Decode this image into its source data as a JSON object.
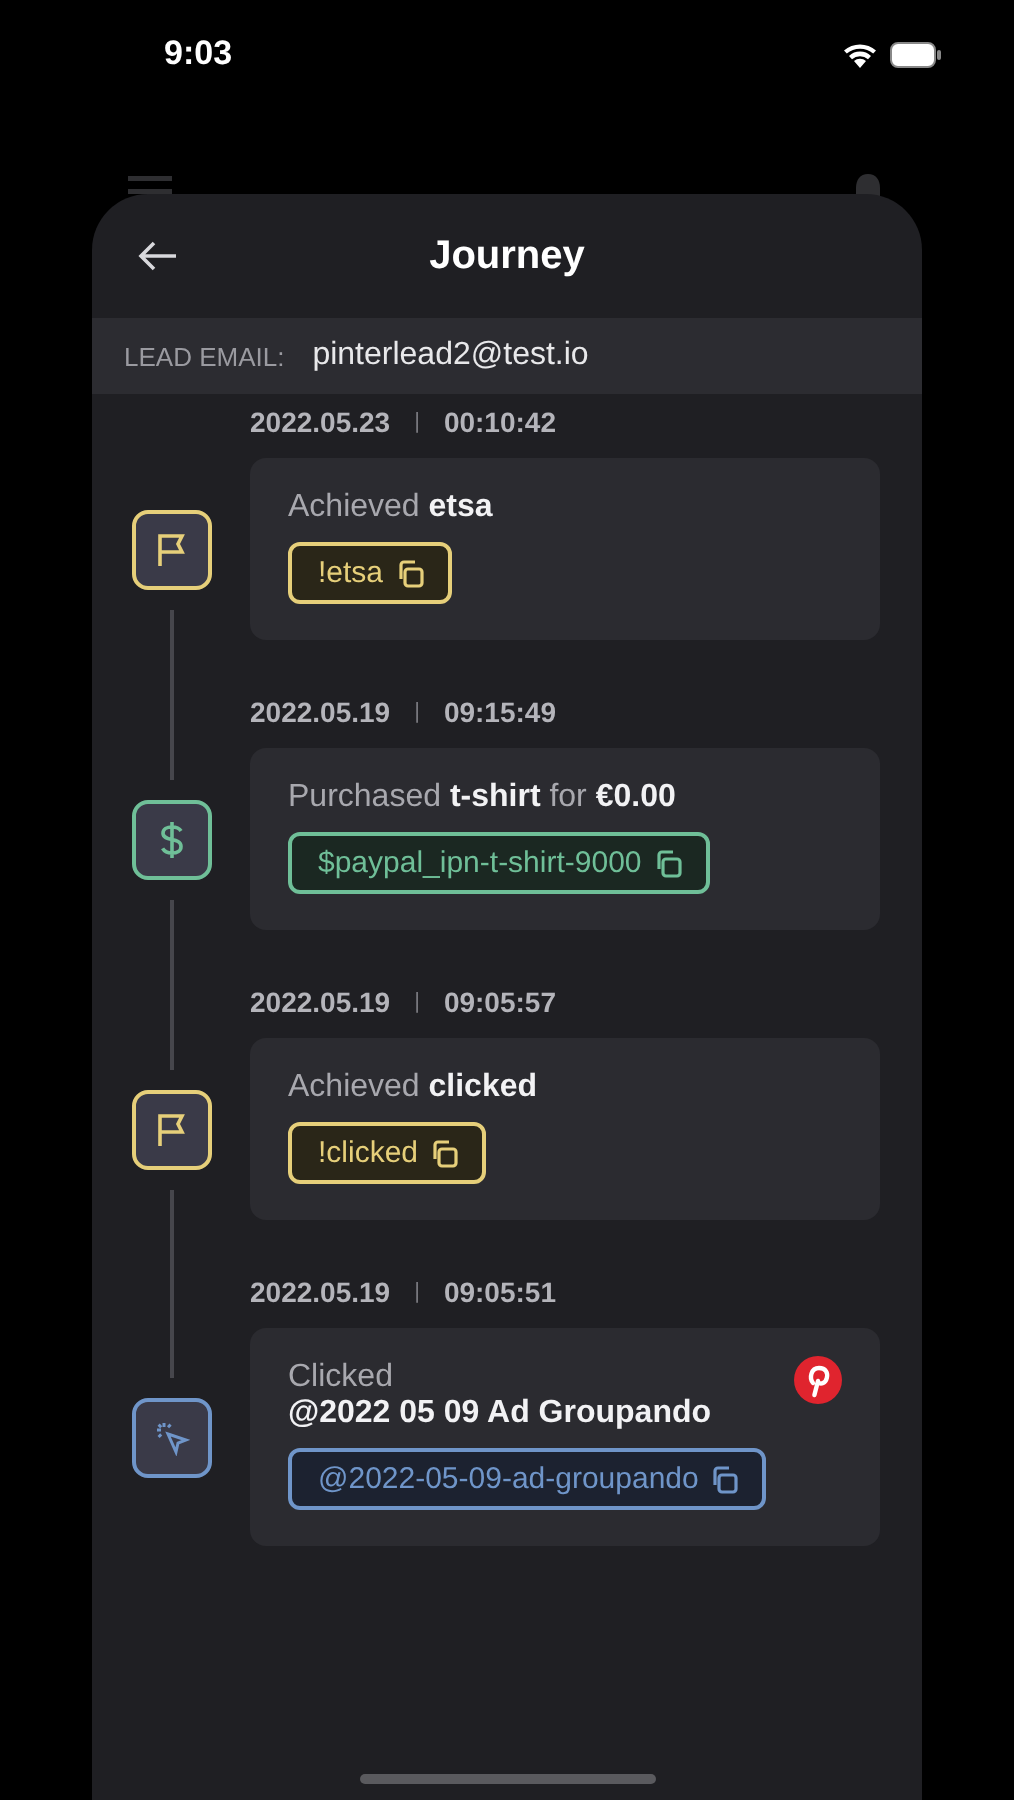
{
  "status_bar": {
    "time": "9:03"
  },
  "sheet": {
    "title": "Journey",
    "lead_label": "LEAD EMAIL:",
    "lead_email": "pinterlead2@test.io"
  },
  "events": [
    {
      "kind": "goal",
      "date": "2022.05.23",
      "separator": "|",
      "time": "00:10:42",
      "description": "Achieved **etsa**",
      "tag": "!etsa"
    },
    {
      "kind": "purchase",
      "date": "2022.05.19",
      "separator": "|",
      "time": "09:15:49",
      "description": "Purchased **t-shirt**  for **€0.00**",
      "tag": "$paypal_ipn-t-shirt-9000"
    },
    {
      "kind": "goal",
      "date": "2022.05.19",
      "separator": "|",
      "time": "09:05:57",
      "description": "Achieved **clicked**",
      "tag": "!clicked"
    },
    {
      "kind": "click",
      "date": "2022.05.19",
      "separator": "|",
      "time": "09:05:51",
      "description": "Clicked",
      "detail": "@2022 05 09 Ad Groupando",
      "source": {
        "kind": "pinterest"
      },
      "tag": "@2022-05-09-ad-groupando"
    }
  ]
}
